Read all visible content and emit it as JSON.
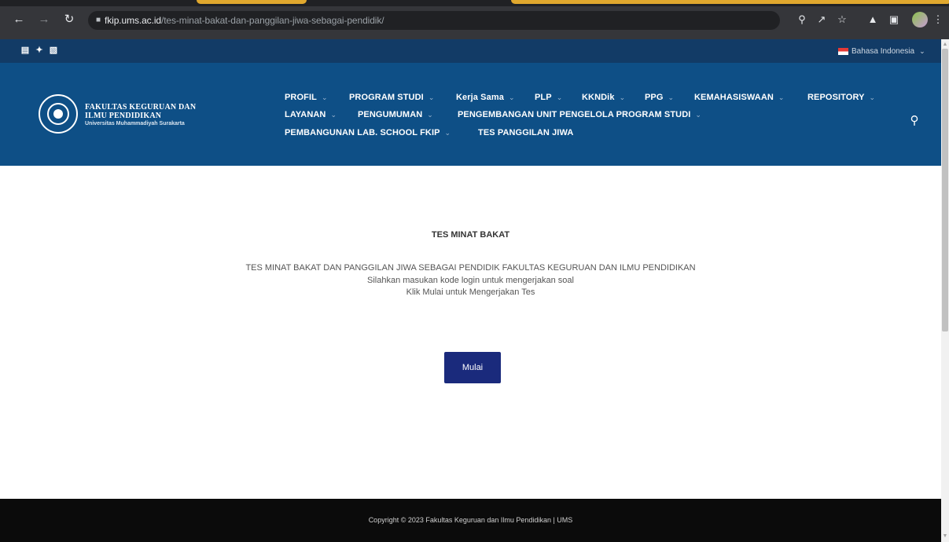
{
  "browser": {
    "url_host": "fkip.ums.ac.id",
    "url_path": "/tes-minat-bakat-dan-panggilan-jiwa-sebagai-pendidik/",
    "icons": [
      "back-icon",
      "forward-icon",
      "reload-icon",
      "lock-icon",
      "zoom-icon",
      "share-icon",
      "star-icon",
      "extensions-icon",
      "window-icon",
      "profile-avatar",
      "menu-icon"
    ]
  },
  "topbar": {
    "social_icons": [
      "rss-icon",
      "twitter-icon",
      "instagram-icon"
    ],
    "language": "Bahasa Indonesia"
  },
  "header": {
    "logo_line1": "FAKULTAS KEGURUAN DAN",
    "logo_line2": "ILMU PENDIDIKAN",
    "logo_line3": "Universitas Muhammadiyah Surakarta",
    "menu": [
      {
        "label": "PROFIL",
        "dropdown": true
      },
      {
        "label": "PROGRAM STUDI",
        "dropdown": true
      },
      {
        "label": "Kerja Sama",
        "dropdown": true
      },
      {
        "label": "PLP",
        "dropdown": true
      },
      {
        "label": "KKNDik",
        "dropdown": true
      },
      {
        "label": "PPG",
        "dropdown": true
      },
      {
        "label": "KEMAHASISWAAN",
        "dropdown": true
      },
      {
        "label": "REPOSITORY",
        "dropdown": true
      },
      {
        "label": "LAYANAN",
        "dropdown": true
      },
      {
        "label": "PENGUMUMAN",
        "dropdown": true
      },
      {
        "label": "PENGEMBANGAN UNIT PENGELOLA PROGRAM STUDI",
        "dropdown": true
      },
      {
        "label": "PEMBANGUNAN LAB. SCHOOL FKIP",
        "dropdown": true
      },
      {
        "label": "TES PANGGILAN JIWA",
        "dropdown": false
      }
    ]
  },
  "main": {
    "title": "TES MINAT BAKAT",
    "line1": "TES MINAT BAKAT DAN PANGGILAN JIWA SEBAGAI PENDIDIK FAKULTAS KEGURUAN DAN ILMU PENDIDIKAN",
    "line2": "Silahkan masukan kode login untuk mengerjakan soal",
    "line3": "Klik Mulai untuk Mengerjakan Tes",
    "button_label": "Mulai"
  },
  "footer": {
    "copyright": "Copyright © 2023 Fakultas Keguruan dan Ilmu Pendidikan | UMS"
  },
  "colors": {
    "header": "#0e4f86",
    "topbar": "#123b66",
    "button": "#1a2a7c",
    "footer": "#0b0b0b"
  }
}
